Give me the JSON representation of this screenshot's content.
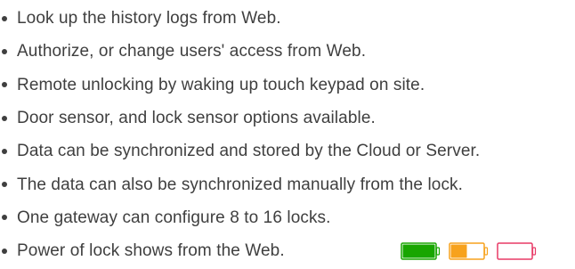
{
  "features": [
    "Look up the history logs from Web.",
    "Authorize, or change users' access from Web.",
    "Remote unlocking by waking up touch keypad on site.",
    "Door sensor, and lock sensor options available.",
    "Data can be synchronized and stored by the Cloud or Server.",
    "The data can also be synchronized manually from the lock.",
    "One gateway can configure 8 to 16 locks.",
    "Power of lock shows from the Web."
  ],
  "battery_levels": [
    {
      "name": "full",
      "level": 1.0,
      "color": "#18a600",
      "outline": "#18a600"
    },
    {
      "name": "half",
      "level": 0.5,
      "color": "#f7a21d",
      "outline": "#f7a21d"
    },
    {
      "name": "empty",
      "level": 0.0,
      "color": "#ffffff",
      "outline": "#e83a67"
    }
  ]
}
